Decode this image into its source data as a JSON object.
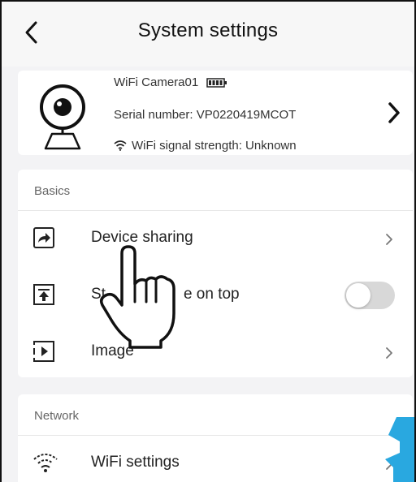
{
  "header": {
    "title": "System settings"
  },
  "device": {
    "name": "WiFi Camera01",
    "serial": "Serial number: VP0220419MCOT",
    "wifi_signal": "WiFi signal strength: Unknown"
  },
  "basics": {
    "section_label": "Basics",
    "items": [
      {
        "label": "Device sharing",
        "icon": "share-icon",
        "control": "chevron"
      },
      {
        "label": "St",
        "label_tail": "e on top",
        "icon": "pin-to-top-icon",
        "control": "toggle",
        "toggle_on": false
      },
      {
        "label": "Image",
        "icon": "play-box-icon",
        "control": "chevron"
      }
    ]
  },
  "network": {
    "section_label": "Network",
    "items": [
      {
        "label": "WiFi settings",
        "icon": "wifi-icon",
        "control": "chevron"
      }
    ]
  },
  "colors": {
    "toggle_off": "#d8d8d8",
    "accent_blue": "#29a8e0"
  }
}
